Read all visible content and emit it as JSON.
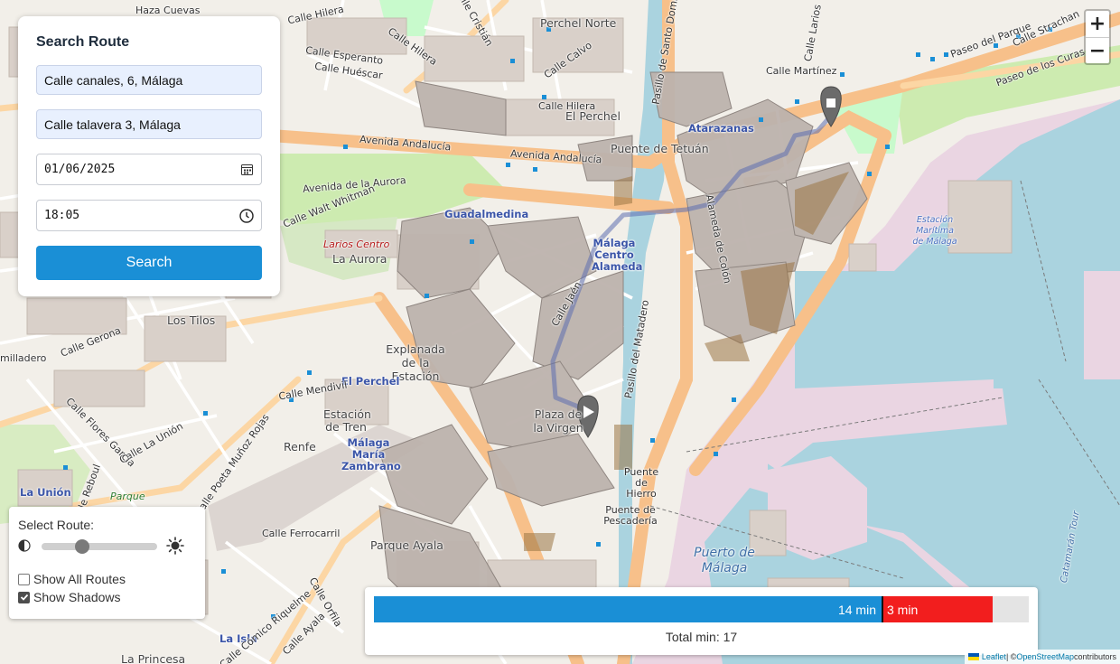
{
  "search": {
    "title": "Search Route",
    "origin": "Calle canales, 6, Málaga",
    "destination": "Calle talavera 3, Málaga",
    "date": "01/06/2025",
    "time": "18:05",
    "button": "Search"
  },
  "zoom": {
    "in": "+",
    "out": "−"
  },
  "route_selector": {
    "label": "Select Route:",
    "slider_level": 0.35,
    "show_all_routes": {
      "label": "Show All Routes",
      "checked": false
    },
    "show_shadows": {
      "label": "Show Shadows",
      "checked": true
    }
  },
  "time_bar": {
    "walk_label": "14 min",
    "walk_minutes": 14,
    "wait_label": "3 min",
    "wait_minutes": 3,
    "total": "Total min: 17",
    "colors": {
      "walk": "#1a8fd6",
      "wait": "#f21e1e"
    }
  },
  "attribution": {
    "leaflet": "Leaflet",
    "sep": " | © ",
    "osm": "OpenStreetMap",
    "contributors": " contributors"
  },
  "map_labels": [
    "Haza Cuevas",
    "Calle Hilera",
    "Calle Esperanto",
    "Calle Huéscar",
    "Calle Hilera",
    "Perchel Norte",
    "Calle Cristián",
    "Calle Calvo",
    "Pasillo de Santo Domingo",
    "Calle Hilera",
    "El Perchel",
    "Avenida Andalucía",
    "Avenida Andalucía",
    "Avenida de la Aurora",
    "Calle Walt Whitman",
    "Puente de Tetuán",
    "Atarazanas",
    "Calle Martínez",
    "Paseo del Parque",
    "Paseo de los Curas",
    "Guadalmedina",
    "Larios Centro",
    "La Aurora",
    "Málaga Centro Alameda",
    "Los Tilos",
    "Explanada de la Estación",
    "Estación de Tren",
    "El Perchel",
    "Calle Mendivil",
    "Renfe",
    "Málaga María Zambrano",
    "Estación Marítima de Málaga",
    "La Unión",
    "Parque",
    "Calle Ferrocarril",
    "Parque Ayala",
    "Puente de Hierro",
    "Puente de Pescadería",
    "Puerto de Málaga",
    "La Isla",
    "La Princesa",
    "Alameda de Colón",
    "Pasillo del Matadero",
    "Calle Ayala",
    "Calle La Unión",
    "Plaza de la Virgen",
    "Calle Strachan",
    "Calle Larios",
    "Calle Gerona",
    "milladero",
    "Calle Flores García",
    "Calle Poeta Muñoz Rojas",
    "Calle Reboul",
    "Calle Cómico Riquelme",
    "Calle Orfila",
    "Calle Jaén",
    "Catamarán Tour"
  ]
}
